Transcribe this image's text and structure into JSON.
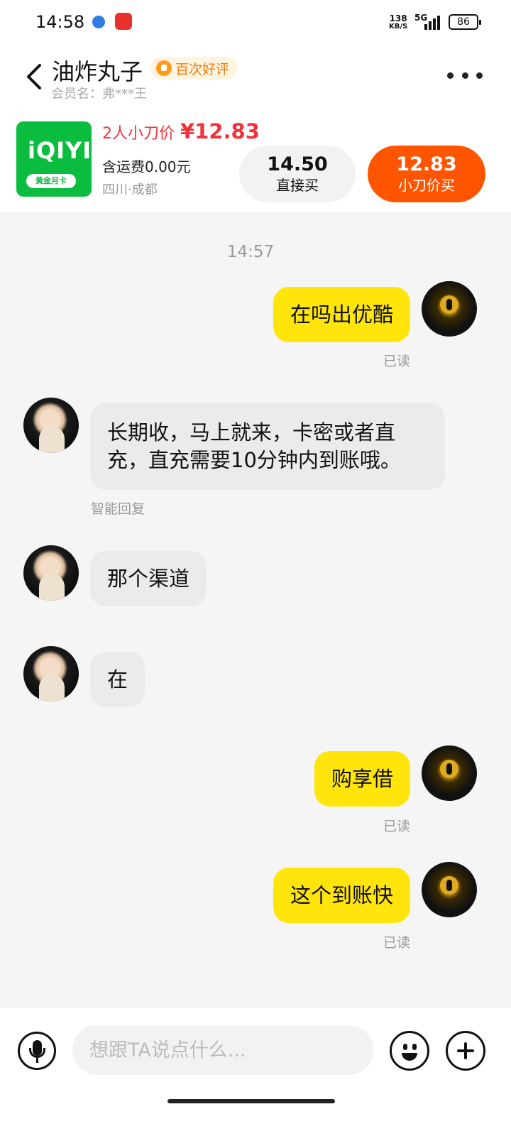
{
  "status_bar": {
    "time": "14:58",
    "net_speed_value": "138",
    "net_speed_unit": "KB/S",
    "network": "5G",
    "battery": "86"
  },
  "header": {
    "seller_name": "油炸丸子",
    "badge": "百次好评",
    "member_label": "会员名：弗***王"
  },
  "product": {
    "thumb_logo": "iQIYI",
    "thumb_subtitle": "黄金月卡",
    "price_label": "2人小刀价",
    "price_value": "¥12.83",
    "shipping": "含运费0.00元",
    "location": "四川·成都",
    "direct_price": "14.50",
    "direct_label": "直接买",
    "cut_price": "12.83",
    "cut_label": "小刀价买"
  },
  "chat": {
    "timestamp": "14:57",
    "messages": [
      {
        "from": "me",
        "text": "在吗出优酷",
        "status": "已读"
      },
      {
        "from": "them",
        "line1": "长期收，马上就来，卡密或者直",
        "line2": "充，直充需要10分钟内到账哦。",
        "tag": "智能回复"
      },
      {
        "from": "them",
        "text": "那个渠道"
      },
      {
        "from": "them",
        "text": "在"
      },
      {
        "from": "me",
        "text": "购享借",
        "status": "已读"
      },
      {
        "from": "me",
        "text": "这个到账快",
        "status": "已读"
      }
    ]
  },
  "input": {
    "placeholder": "想跟TA说点什么..."
  },
  "colors": {
    "my_bubble": "#ffe50c",
    "their_bubble": "#ebebeb",
    "accent_red": "#f2323b",
    "buy_button": "#ff5500",
    "badge_orange": "#ee7a12"
  }
}
